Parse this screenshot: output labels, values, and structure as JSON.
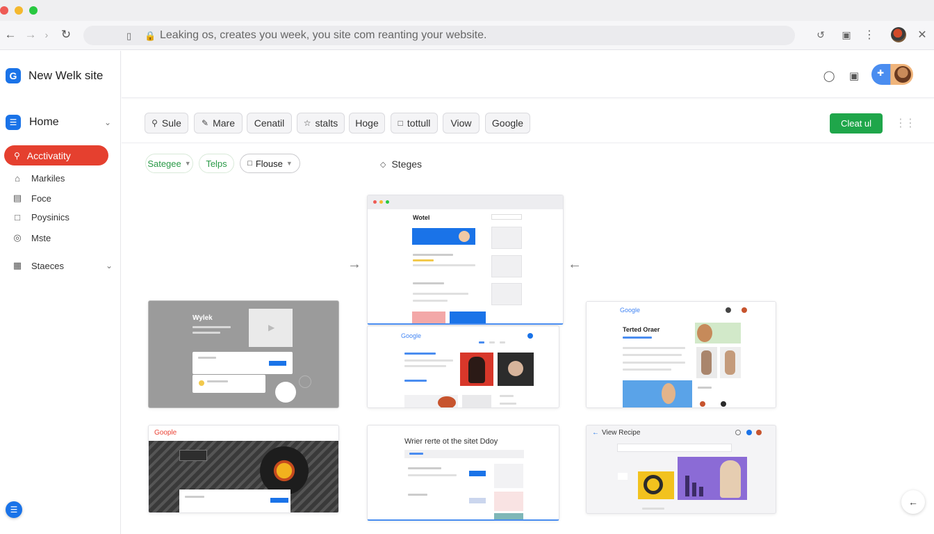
{
  "browser": {
    "url_text": "Leaking os, creates you week, you site com reanting your website.",
    "traffic_lights": [
      "#ee5b55",
      "#f4b82e",
      "#28c840"
    ]
  },
  "sidebar": {
    "brand_letter": "G",
    "brand_name": "New Welk site",
    "home_label": "Home",
    "active_item": "Acctivatity",
    "items": [
      {
        "label": "Markiles",
        "icon": "house-icon"
      },
      {
        "label": "Foce",
        "icon": "list-icon"
      },
      {
        "label": "Poysinics",
        "icon": "document-icon"
      },
      {
        "label": "Mste",
        "icon": "target-icon"
      }
    ],
    "group_label": "Staeces"
  },
  "toolbar": {
    "chips": [
      {
        "label": "Sule",
        "icon": "search-icon"
      },
      {
        "label": "Mare",
        "icon": "pen-icon"
      },
      {
        "label": "Cenatil",
        "icon": ""
      },
      {
        "label": "stalts",
        "icon": "star-icon"
      },
      {
        "label": "Hoge",
        "icon": ""
      },
      {
        "label": "tottull",
        "icon": "square-icon"
      },
      {
        "label": "Viow",
        "icon": ""
      },
      {
        "label": "Google",
        "icon": ""
      }
    ],
    "cta_label": "Cleat ul"
  },
  "filters": {
    "items": [
      "Sategee",
      "Telps",
      "Flouse"
    ],
    "stages_label": "Steges"
  },
  "cards": {
    "featured": {
      "title": "Wotel"
    },
    "gray": {
      "title": "Wylek"
    },
    "google_mid": {
      "brand": "Google"
    },
    "right_top": {
      "brand": "Google",
      "title": "Terted Oraer"
    },
    "bottom_left": {
      "brand": "Goople"
    },
    "bottom_mid": {
      "title": "Wrier rerte ot the sitet Ddoy"
    },
    "bottom_right": {
      "title": "View Recipe"
    }
  },
  "colors": {
    "accent_blue": "#1a73e8",
    "active_red": "#e5402f",
    "cta_green": "#1fa64a"
  }
}
